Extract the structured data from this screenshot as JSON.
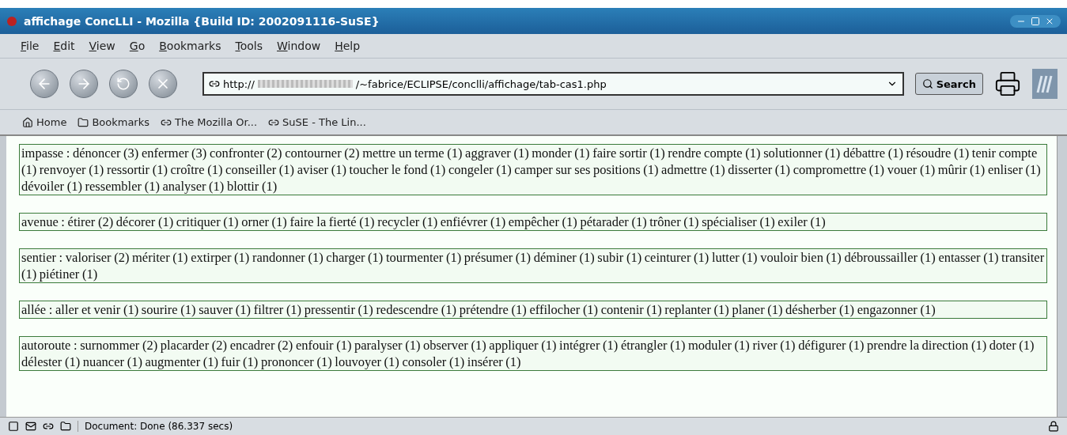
{
  "window": {
    "title": "affichage ConcLLI - Mozilla {Build ID: 2002091116-SuSE}"
  },
  "menu": [
    "File",
    "Edit",
    "View",
    "Go",
    "Bookmarks",
    "Tools",
    "Window",
    "Help"
  ],
  "navigation": {
    "url_start": "http://",
    "url_end": "/~fabrice/ECLIPSE/conclli/affichage/tab-cas1.php",
    "search_button": "Search"
  },
  "personal_toolbar": [
    "Home",
    "Bookmarks",
    "The Mozilla Or...",
    "SuSE - The Lin..."
  ],
  "entries": [
    {
      "text": "impasse : dénoncer (3) enfermer (3) confronter (2) contourner (2) mettre un terme (1) aggraver (1) monder (1) faire sortir (1) rendre compte (1) solutionner (1) débattre (1) résoudre (1) tenir compte (1) renvoyer (1) ressortir (1) croître (1) conseiller (1) aviser (1) toucher le fond (1) congeler (1) camper sur ses positions (1) admettre (1) disserter (1) compromettre (1) vouer (1) mûrir (1) enliser (1) dévoiler (1) ressembler (1) analyser (1) blottir (1)"
    },
    {
      "text": "avenue : étirer (2) décorer (1) critiquer (1) orner (1) faire la fierté (1) recycler (1) enfiévrer (1) empêcher (1) pétarader (1) trôner (1) spécialiser (1) exiler (1)"
    },
    {
      "text": "sentier : valoriser (2) mériter (1) extirper (1) randonner (1) charger (1) tourmenter (1) présumer (1) déminer (1) subir (1) ceinturer (1) lutter (1) vouloir bien (1) débroussailler (1) entasser (1) transiter (1) piétiner (1)"
    },
    {
      "text": "allée : aller et venir (1) sourire (1) sauver (1) filtrer (1) pressentir (1) redescendre (1) prétendre (1) effilocher (1) contenir (1) replanter (1) planer (1) désherber (1) engazonner (1)"
    },
    {
      "text": "autoroute : surnommer (2) placarder (2) encadrer (2) enfouir (1) paralyser (1) observer (1) appliquer (1) intégrer (1) étrangler (1) moduler (1) river (1) défigurer (1) prendre la direction (1) doter (1) délester (1) nuancer (1) augmenter (1) fuir (1) prononcer (1) louvoyer (1) consoler (1) insérer (1)"
    }
  ],
  "status_bar": {
    "text": "Document: Done (86.337 secs)"
  }
}
